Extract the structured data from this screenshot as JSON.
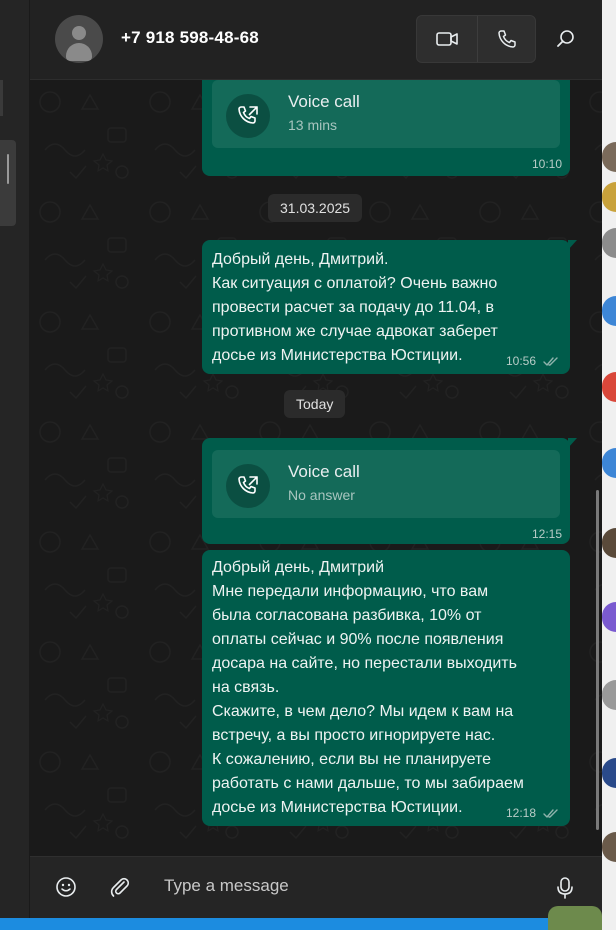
{
  "contact": {
    "name": "+7 918 598-48-68",
    "avatar_icon": "person-placeholder-icon"
  },
  "header_actions": {
    "video_icon": "video-camera-icon",
    "audio_icon": "phone-icon",
    "search_icon": "search-icon"
  },
  "messages": [
    {
      "type": "call",
      "title": "Voice call",
      "detail": "13 mins",
      "time": "10:10",
      "icon": "outgoing-call-icon"
    },
    {
      "type": "date",
      "label": "31.03.2025"
    },
    {
      "type": "text",
      "text": "Добрый день, Дмитрий.\nКак ситуация с оплатой? Очень важно\nпровести расчет за подачу до 11.04, в\nпротивном же случае адвокат заберет\nдосье из Министерства Юстиции.",
      "time": "10:56",
      "status": "read"
    },
    {
      "type": "date",
      "label": "Today"
    },
    {
      "type": "call",
      "title": "Voice call",
      "detail": "No answer",
      "time": "12:15",
      "icon": "outgoing-call-icon"
    },
    {
      "type": "text",
      "text": "Добрый день, Дмитрий\nМне передали информацию, что вам\nбыла согласована разбивка, 10% от\nоплаты сейчас и 90% после появления\nдосара на сайте, но перестали выходить\nна связь.\nСкажите, в чем дело? Мы идем к вам на\nвстречу, а вы просто игнорируете нас.\nК сожалению, если вы не планируете\nработать с нами дальше, то мы забираем\nдосье из Министерства Юстиции.",
      "time": "12:18",
      "status": "read"
    }
  ],
  "composer": {
    "placeholder": "Type a message",
    "emoji_icon": "emoji-icon",
    "attach_icon": "paperclip-icon",
    "mic_icon": "microphone-icon"
  },
  "colors": {
    "outgoing_bubble": "#005c4b",
    "call_card": "#146a59",
    "chat_background": "#1a1a1a",
    "header": "#222222"
  }
}
